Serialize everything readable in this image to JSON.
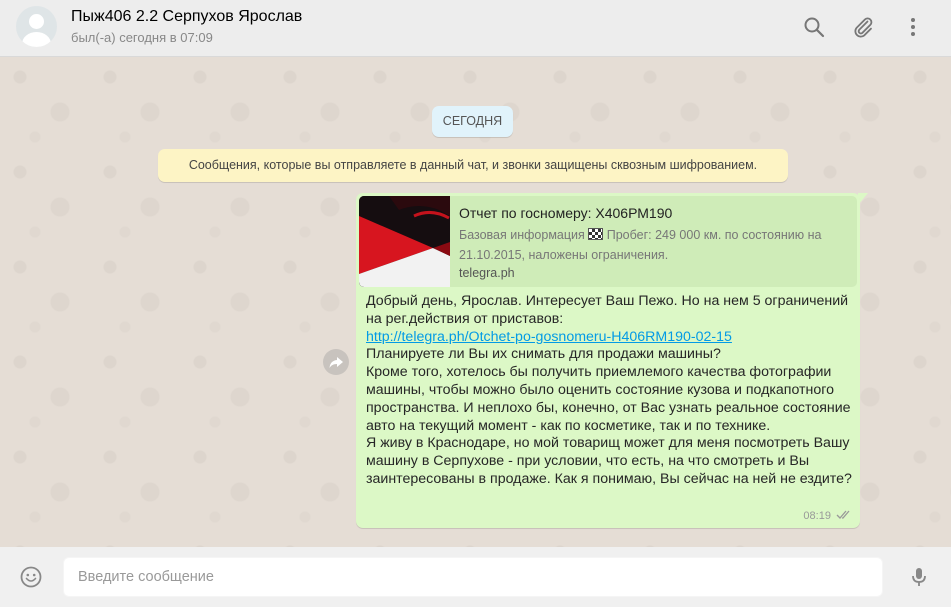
{
  "header": {
    "contact_name": "Пыж406 2.2 Серпухов Ярослав",
    "status": "был(-а) сегодня в 07:09",
    "icons": [
      "search-icon",
      "paperclip-icon",
      "menu-icon"
    ]
  },
  "chat": {
    "date_label": "СЕГОДНЯ",
    "encryption_notice": "Сообщения, которые вы отправляете в данный чат, и звонки защищены сквозным шифрованием.",
    "message": {
      "preview": {
        "title": "Отчет по госномеру: Х406РМ190",
        "desc_before_flag": "Базовая информация ",
        "desc_after_flag": " Пробег: 249 000 км. по состоянию на 21.10.2015, наложены ограничения.",
        "domain": "telegra.ph"
      },
      "line1": "Добрый день, Ярослав. Интересует Ваш Пежо. Но на нем 5 ограничений на рег.действия от приставов:",
      "link": "http://telegra.ph/Otchet-po-gosnomeru-H406RM190-02-15",
      "line2": "Планируете ли Вы их снимать для продажи машины?",
      "line3": "Кроме того, хотелось бы получить приемлемого качества фотографии машины, чтобы можно было оценить состояние кузова и подкапотного пространства. И неплохо бы, конечно, от Вас узнать реальное состояние авто на текущий момент - как по косметике, так и по технике.",
      "line4": "Я живу в Краснодаре, но мой товарищ может для меня посмотреть Вашу машину в Серпухове - при условии, что есть, на что смотреть и Вы заинтересованы в продаже. Как я понимаю, Вы сейчас на ней не ездите?",
      "time": "08:19",
      "status_icon": "double-check-icon"
    }
  },
  "composer": {
    "placeholder": "Введите сообщение",
    "icons": [
      "emoji-icon",
      "microphone-icon"
    ]
  },
  "colors": {
    "outgoing_bubble": "#dcf8c6",
    "link": "#039be5",
    "header_bg": "#ededed",
    "chat_bg": "#e5ddd5",
    "notice_bg": "#fdf4c5",
    "date_chip_bg": "#e1f3fb"
  }
}
